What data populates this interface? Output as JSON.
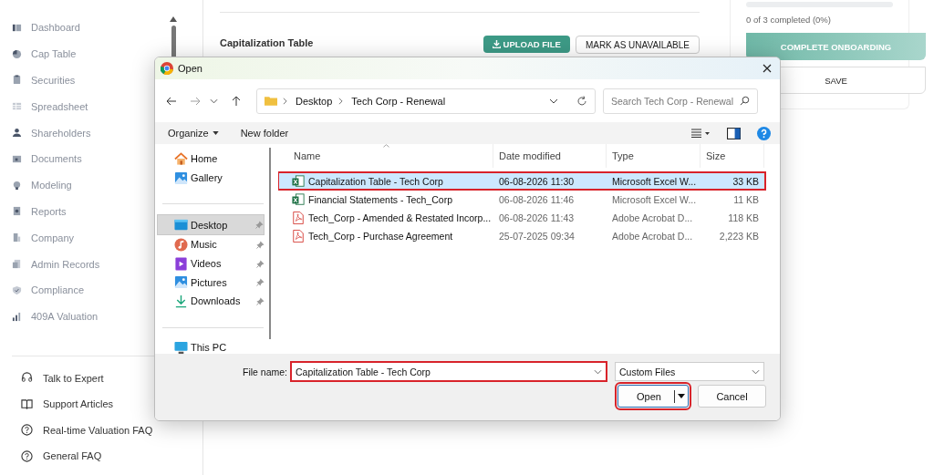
{
  "sidebar": {
    "nav_items": [
      {
        "label": "Dashboard"
      },
      {
        "label": "Cap Table"
      },
      {
        "label": "Securities"
      },
      {
        "label": "Spreadsheet"
      },
      {
        "label": "Shareholders"
      },
      {
        "label": "Documents"
      },
      {
        "label": "Modeling"
      },
      {
        "label": "Reports"
      },
      {
        "label": "Company"
      },
      {
        "label": "Admin Records"
      },
      {
        "label": "Compliance"
      },
      {
        "label": "409A Valuation"
      }
    ],
    "help_links": [
      {
        "label": "Talk to Expert",
        "kind": "headset"
      },
      {
        "label": "Support Articles",
        "kind": "book"
      },
      {
        "label": "Real-time Valuation FAQ",
        "kind": "question"
      },
      {
        "label": "General FAQ",
        "kind": "question"
      }
    ]
  },
  "section": {
    "title": "Capitalization Table",
    "buttons": [
      {
        "label": "UPLOAD FILE",
        "kind": "primary"
      },
      {
        "label": "MARK AS UNAVAILABLE",
        "kind": "outline"
      }
    ]
  },
  "onboarding": {
    "progress": {
      "level": 0
    },
    "status": "0 of 3 completed (0%)",
    "buttons": [
      {
        "label": "COMPLETE ONBOARDING",
        "kind": "primary"
      },
      {
        "label": "SAVE",
        "kind": "outline"
      }
    ]
  },
  "dialog": {
    "title": "Open",
    "breadcrumb": [
      "Desktop",
      "Tech Corp - Renewal"
    ],
    "search": {
      "placeholder": "Search Tech Corp - Renewal"
    },
    "toolbar": [
      {
        "label": "Organize",
        "kind": "menu"
      },
      {
        "label": "New folder",
        "kind": "plain"
      }
    ],
    "nav_groups": [
      [
        {
          "label": "Home",
          "kind": "home",
          "selected": false,
          "pinned": false
        },
        {
          "label": "Gallery",
          "kind": "gallery",
          "selected": false,
          "pinned": false
        }
      ],
      [
        {
          "label": "Desktop",
          "kind": "desktop",
          "selected": true,
          "pinned": true
        },
        {
          "label": "Music",
          "kind": "music",
          "selected": false,
          "pinned": true
        },
        {
          "label": "Videos",
          "kind": "videos",
          "selected": false,
          "pinned": true
        },
        {
          "label": "Pictures",
          "kind": "pictures",
          "selected": false,
          "pinned": true
        },
        {
          "label": "Downloads",
          "kind": "downloads",
          "selected": false,
          "pinned": true
        }
      ],
      [
        {
          "label": "This PC",
          "kind": "pc",
          "selected": false,
          "pinned": false
        }
      ]
    ],
    "columns": [
      "Name",
      "Date modified",
      "Type",
      "Size"
    ],
    "files": [
      {
        "name": "Capitalization Table - Tech Corp",
        "date": "06-08-2026 11:30",
        "type": "Microsoft Excel W...",
        "size": "33 KB",
        "kind": "excel",
        "selected": true,
        "highlighted": true
      },
      {
        "name": "Financial Statements - Tech_Corp",
        "date": "06-08-2026 11:46",
        "type": "Microsoft Excel W...",
        "size": "11 KB",
        "kind": "excel",
        "selected": false,
        "highlighted": false
      },
      {
        "name": "Tech_Corp - Amended & Restated Incorp...",
        "date": "06-08-2026 11:43",
        "type": "Adobe Acrobat D...",
        "size": "118 KB",
        "kind": "pdf",
        "selected": false,
        "highlighted": false
      },
      {
        "name": "Tech_Corp - Purchase Agreement",
        "date": "25-07-2025 09:34",
        "type": "Adobe Acrobat D...",
        "size": "2,223 KB",
        "kind": "pdf",
        "selected": false,
        "highlighted": false
      }
    ],
    "file_name": {
      "label": "File name:",
      "value": "Capitalization Table - Tech Corp",
      "highlighted": true
    },
    "file_type": {
      "value": "Custom Files"
    },
    "buttons": [
      {
        "label": "Open",
        "kind": "split",
        "highlighted": true
      },
      {
        "label": "Cancel",
        "kind": "plain",
        "highlighted": false
      }
    ]
  }
}
